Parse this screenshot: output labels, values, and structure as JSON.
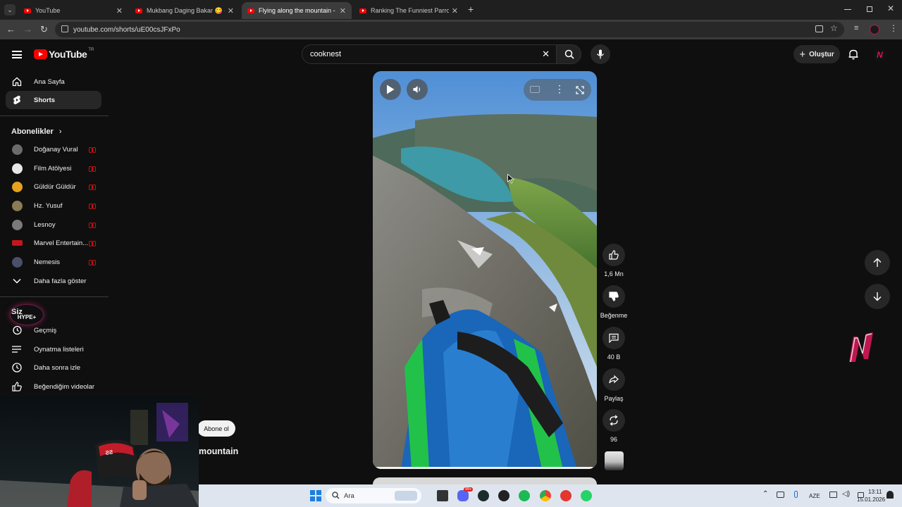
{
  "browser": {
    "tabs": [
      {
        "title": "YouTube",
        "active": false
      },
      {
        "title": "Mukbang Daging Bakar 😋 - Yo",
        "active": false
      },
      {
        "title": "Flying along the mountain - Yo",
        "active": true
      },
      {
        "title": "Ranking The Funniest Parrot Mo",
        "active": false
      }
    ],
    "url": "youtube.com/shorts/uE00csJFxPo"
  },
  "header": {
    "logo_text": "YouTube",
    "logo_region": "TR",
    "search_value": "cooknest",
    "create_label": "Oluştur"
  },
  "sidebar": {
    "main": [
      {
        "label": "Ana Sayfa",
        "icon": "home-icon"
      },
      {
        "label": "Shorts",
        "icon": "shorts-icon",
        "active": true
      }
    ],
    "subscriptions_title": "Abonelikler",
    "subscriptions": [
      {
        "label": "Doğanay Vural",
        "color": "#6b6b6b"
      },
      {
        "label": "Film Atölyesi",
        "color": "#e8e8e8"
      },
      {
        "label": "Güldür Güldür",
        "color": "#e6a11f"
      },
      {
        "label": "Hz. Yusuf",
        "color": "#8a7a55"
      },
      {
        "label": "Lesnoy",
        "color": "#7a7a7a"
      },
      {
        "label": "Marvel Entertain...",
        "color": "#c4161c"
      },
      {
        "label": "Nemesis",
        "color": "#4a4f6a"
      }
    ],
    "show_more": "Daha fazla göster",
    "you_title": "Siz",
    "you_items": [
      {
        "label": "Geçmiş",
        "icon": "history-icon"
      },
      {
        "label": "Oynatma listeleri",
        "icon": "playlist-icon"
      },
      {
        "label": "Daha sonra izle",
        "icon": "watch-later-icon"
      },
      {
        "label": "Beğendiğim videolar",
        "icon": "liked-icon"
      }
    ],
    "hype_badge": "HYPE+"
  },
  "video": {
    "subscribe_label": "Abone ol",
    "title_fragment": "mountain"
  },
  "actions": {
    "likes": "1,6 Mn",
    "dislike_label": "Beğenme",
    "comments": "40 B",
    "share_label": "Paylaş",
    "remix_count": "96"
  },
  "taskbar": {
    "search_placeholder": "Ara",
    "lang": "AZE",
    "time": "13:11",
    "date": "15.01.2026",
    "discord_badge": "99+"
  },
  "colors": {
    "yt_red": "#ff0000",
    "bg": "#0f0f0f",
    "brand_accent": "#e0115f"
  }
}
